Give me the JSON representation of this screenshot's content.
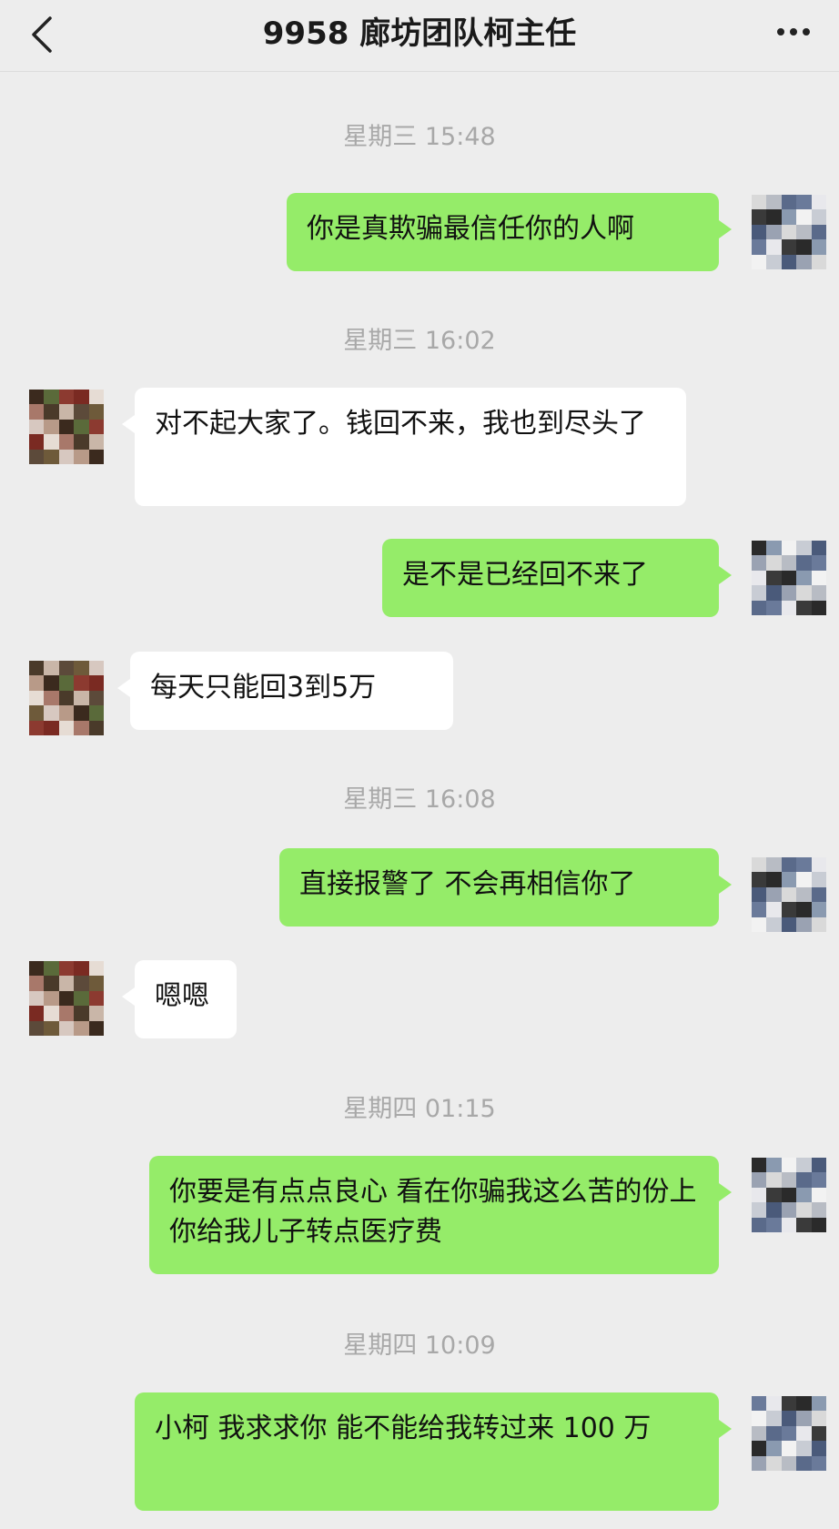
{
  "header": {
    "title": "9958 廊坊团队柯主任",
    "back_icon": "chevron-left-icon",
    "more_icon": "more-dots-icon"
  },
  "colors": {
    "sent_bubble": "#95ec69",
    "received_bubble": "#ffffff",
    "background": "#ededed",
    "timestamp": "#a8a8a8"
  },
  "messages": [
    {
      "type": "timestamp",
      "text": "星期三 15:48"
    },
    {
      "type": "sent",
      "text": "你是真欺骗最信任你的人啊"
    },
    {
      "type": "timestamp",
      "text": "星期三 16:02"
    },
    {
      "type": "received",
      "text": "对不起大家了。钱回不来，我也到尽头了"
    },
    {
      "type": "sent",
      "text": "是不是已经回不来了"
    },
    {
      "type": "received",
      "text": "每天只能回3到5万"
    },
    {
      "type": "timestamp",
      "text": "星期三 16:08"
    },
    {
      "type": "sent",
      "text": "直接报警了 不会再相信你了"
    },
    {
      "type": "received",
      "text": "嗯嗯"
    },
    {
      "type": "timestamp",
      "text": "星期四 01:15"
    },
    {
      "type": "sent",
      "text": "你要是有点点良心 看在你骗我这么苦的份上 你给我儿子转点医疗费"
    },
    {
      "type": "timestamp",
      "text": "星期四 10:09"
    },
    {
      "type": "sent",
      "text": "小柯 我求求你 能不能给我转过来 100 万"
    }
  ]
}
